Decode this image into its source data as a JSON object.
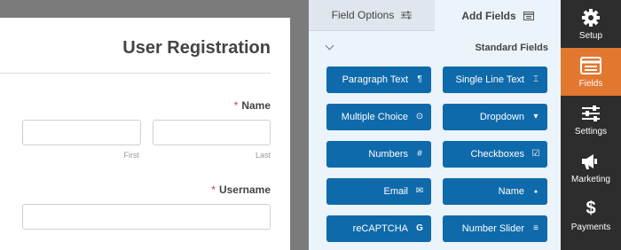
{
  "form": {
    "title": "User Registration",
    "required_marker": "*",
    "name_label": "Name",
    "first_sublabel": "First",
    "last_sublabel": "Last",
    "username_label": "Username",
    "first_value": "",
    "last_value": "",
    "username_value": ""
  },
  "panel": {
    "tabs": [
      {
        "label": "Field Options",
        "icon": "sliders-icon"
      },
      {
        "label": "Add Fields",
        "icon": "list-icon"
      }
    ],
    "section_title": "Standard Fields",
    "buttons": [
      {
        "label": "Paragraph Text",
        "icon": "paragraph-icon",
        "glyph": "¶"
      },
      {
        "label": "Single Line Text",
        "icon": "text-cursor-icon",
        "glyph": "⌶"
      },
      {
        "label": "Multiple Choice",
        "icon": "radio-icon",
        "glyph": "⊙"
      },
      {
        "label": "Dropdown",
        "icon": "caret-square-icon",
        "glyph": "▾"
      },
      {
        "label": "Numbers",
        "icon": "hash-icon",
        "glyph": "#"
      },
      {
        "label": "Checkboxes",
        "icon": "checkbox-icon",
        "glyph": "☑"
      },
      {
        "label": "Email",
        "icon": "envelope-icon",
        "glyph": "✉"
      },
      {
        "label": "Name",
        "icon": "user-icon",
        "glyph": "●"
      },
      {
        "label": "reCAPTCHA",
        "icon": "google-icon",
        "glyph": "G"
      },
      {
        "label": "Number Slider",
        "icon": "sliders-icon",
        "glyph": "≡"
      }
    ]
  },
  "sidebar": {
    "items": [
      {
        "label": "Setup",
        "icon": "gear-icon"
      },
      {
        "label": "Fields",
        "icon": "fields-list-icon"
      },
      {
        "label": "Settings",
        "icon": "sliders-icon"
      },
      {
        "label": "Marketing",
        "icon": "megaphone-icon"
      },
      {
        "label": "Payments",
        "icon": "dollar-icon"
      }
    ]
  },
  "colors": {
    "accent_orange": "#e27730",
    "button_blue": "#0e6aab",
    "sidebar_dark": "#2d2d2d",
    "panel_bg": "#ebf3fb",
    "required_red": "#d63638"
  }
}
